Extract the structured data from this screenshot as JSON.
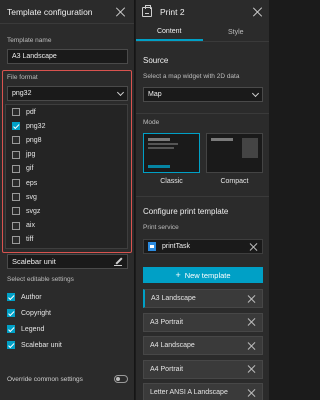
{
  "left": {
    "title": "Template configuration",
    "template_name_label": "Template name",
    "template_name_value": "A3 Landscape",
    "file_format_label": "File format",
    "file_format_value": "png32",
    "formats": [
      {
        "label": "pdf",
        "checked": false
      },
      {
        "label": "png32",
        "checked": true
      },
      {
        "label": "png8",
        "checked": false
      },
      {
        "label": "jpg",
        "checked": false
      },
      {
        "label": "gif",
        "checked": false
      },
      {
        "label": "eps",
        "checked": false
      },
      {
        "label": "svg",
        "checked": false
      },
      {
        "label": "svgz",
        "checked": false
      },
      {
        "label": "aix",
        "checked": false
      },
      {
        "label": "tiff",
        "checked": false
      }
    ],
    "scalebar_unit_label": "Scalebar unit",
    "select_editable_label": "Select editable settings",
    "editables": [
      {
        "label": "Author",
        "checked": true
      },
      {
        "label": "Copyright",
        "checked": true
      },
      {
        "label": "Legend",
        "checked": true
      },
      {
        "label": "Scalebar unit",
        "checked": true
      }
    ],
    "override_label": "Override common settings"
  },
  "right": {
    "title": "Print 2",
    "tabs": [
      {
        "label": "Content",
        "active": true
      },
      {
        "label": "Style",
        "active": false
      }
    ],
    "source_title": "Source",
    "source_sub": "Select a map widget with 2D data",
    "map_value": "Map",
    "mode_label": "Mode",
    "modes": [
      {
        "label": "Classic",
        "selected": true
      },
      {
        "label": "Compact",
        "selected": false
      }
    ],
    "configure_title": "Configure print template",
    "print_service_label": "Print service",
    "print_service_name": "printTask",
    "new_template_label": "New template",
    "templates": [
      {
        "label": "A3 Landscape",
        "selected": true
      },
      {
        "label": "A3 Portrait",
        "selected": false
      },
      {
        "label": "A4 Landscape",
        "selected": false
      },
      {
        "label": "A4 Portrait",
        "selected": false
      },
      {
        "label": "Letter ANSI A Landscape",
        "selected": false
      }
    ]
  },
  "colors": {
    "accent": "#00a0c6",
    "highlight_border": "#d9534f",
    "panel_bg": "#2b2b2b"
  }
}
